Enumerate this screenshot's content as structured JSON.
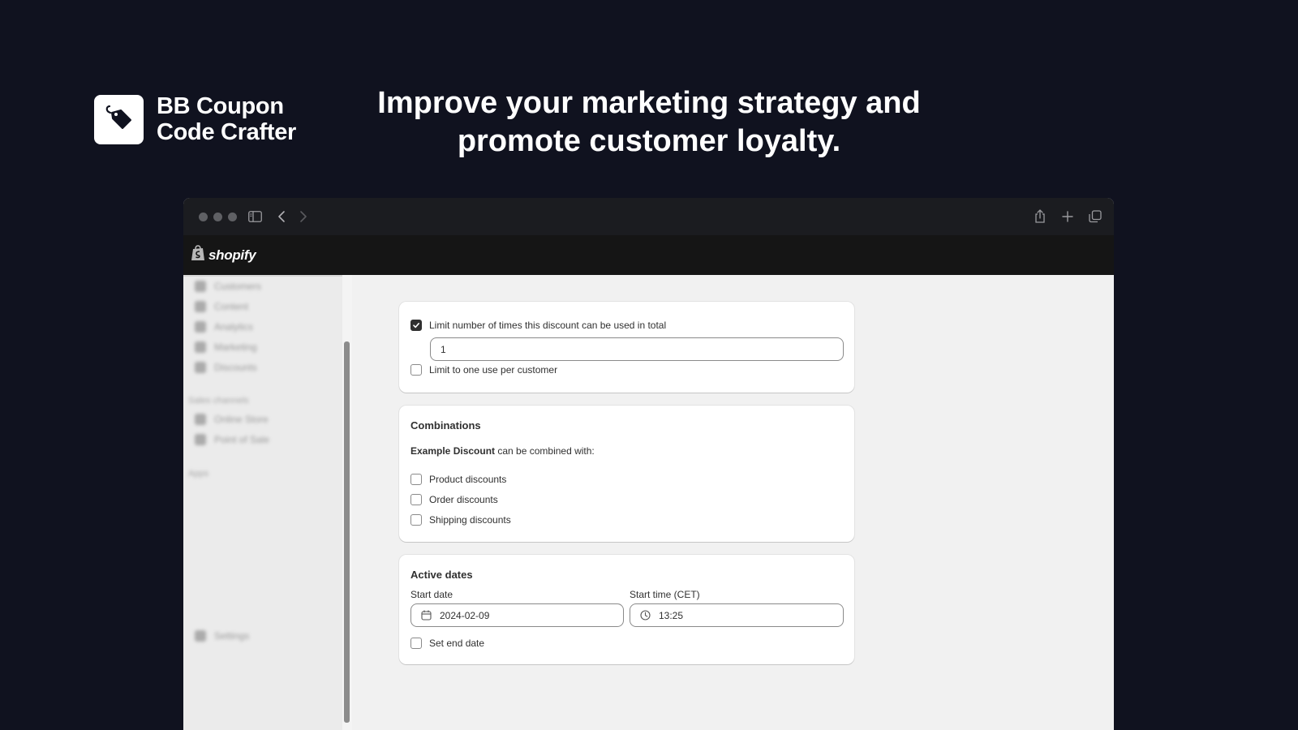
{
  "brand": {
    "name_line1": "BB Coupon",
    "name_line2": "Code Crafter",
    "logo_icon": "tag-icon"
  },
  "headline": "Improve your marketing strategy and\npromote customer loyalty.",
  "browser": {
    "toolbar_icons": [
      "sidebar-toggle-icon",
      "back-icon",
      "forward-icon",
      "share-icon",
      "new-tab-icon",
      "tab-overview-icon"
    ]
  },
  "shopify": {
    "wordmark": "shopify"
  },
  "sidebar": {
    "items": [
      {
        "label": "Customers"
      },
      {
        "label": "Content"
      },
      {
        "label": "Analytics"
      },
      {
        "label": "Marketing"
      },
      {
        "label": "Discounts"
      }
    ],
    "sales_channels_heading": "Sales channels",
    "sales_channels": [
      {
        "label": "Online Store"
      },
      {
        "label": "Point of Sale"
      }
    ],
    "apps_heading": "Apps",
    "settings_label": "Settings"
  },
  "usage_limits": {
    "limit_total_label": "Limit number of times this discount can be used in total",
    "limit_total_checked": true,
    "limit_total_value": "1",
    "limit_per_customer_label": "Limit to one use per customer",
    "limit_per_customer_checked": false
  },
  "combinations": {
    "title": "Combinations",
    "discount_name": "Example Discount",
    "combine_text": " can be combined with:",
    "options": [
      {
        "label": "Product discounts",
        "checked": false
      },
      {
        "label": "Order discounts",
        "checked": false
      },
      {
        "label": "Shipping discounts",
        "checked": false
      }
    ]
  },
  "active_dates": {
    "title": "Active dates",
    "start_date_label": "Start date",
    "start_date_value": "2024-02-09",
    "start_time_label": "Start time (CET)",
    "start_time_value": "13:25",
    "set_end_date_label": "Set end date",
    "set_end_date_checked": false
  },
  "colors": {
    "background": "#10121f",
    "titlebar": "#1b1c20",
    "shopify_bar": "#151515",
    "page_bg": "#f1f1f1",
    "checked": "#303030"
  }
}
